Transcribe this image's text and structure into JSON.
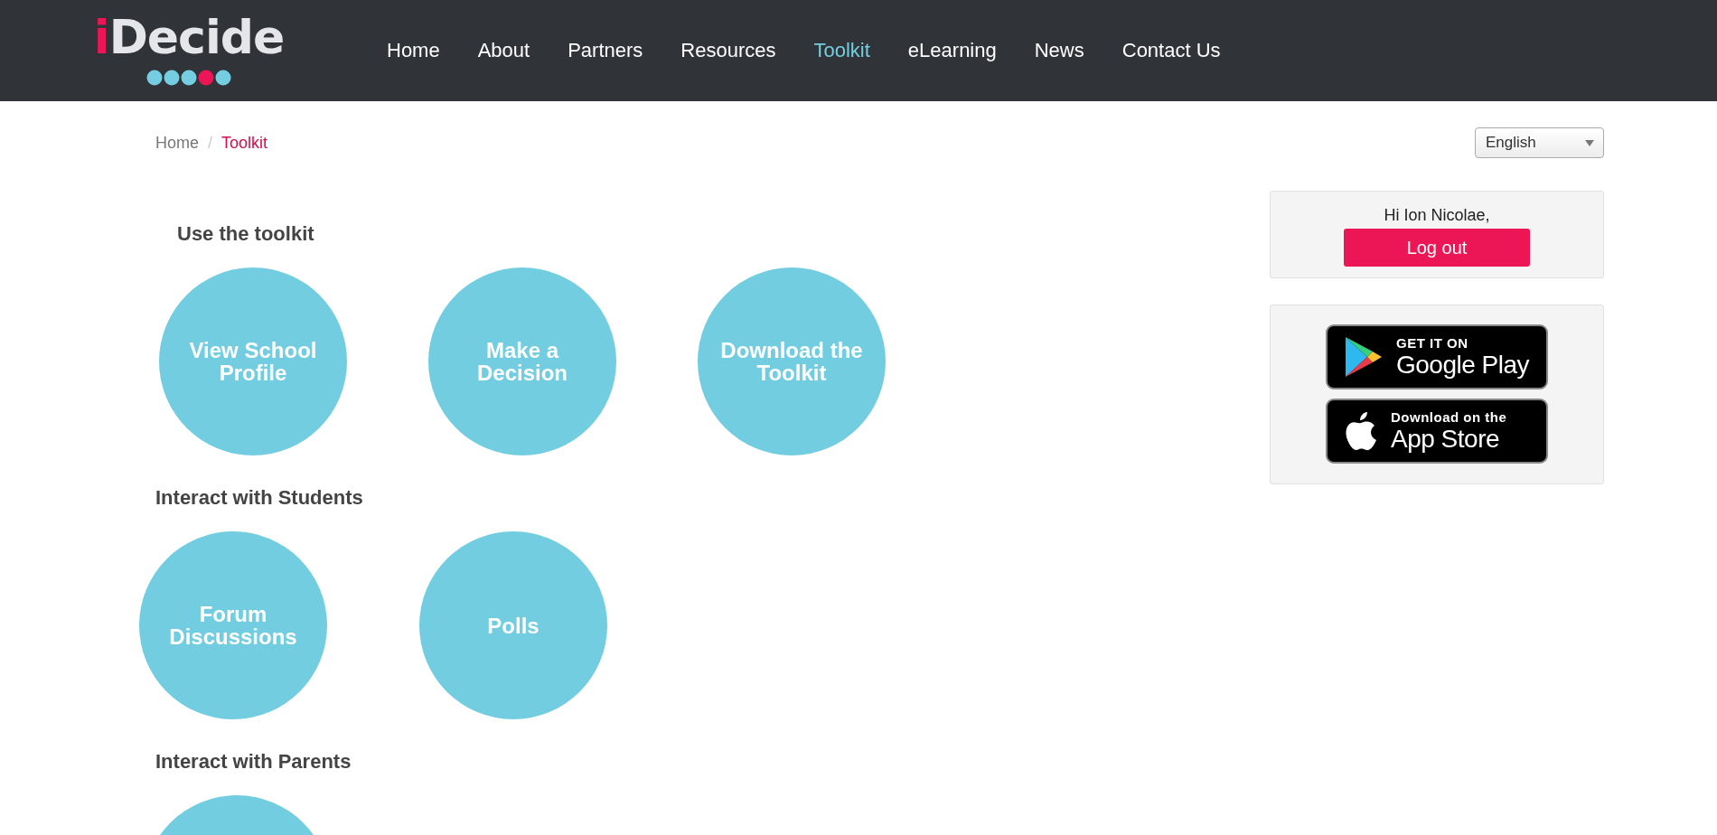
{
  "logo": {
    "accent": "i",
    "text": "Decide",
    "dots": [
      {
        "color": "#74cde0"
      },
      {
        "color": "#74cde0"
      },
      {
        "color": "#74cde0"
      },
      {
        "color": "#ec1656"
      },
      {
        "color": "#74cde0"
      }
    ]
  },
  "nav": [
    {
      "label": "Home",
      "selected": false
    },
    {
      "label": "About",
      "selected": false
    },
    {
      "label": "Partners",
      "selected": false
    },
    {
      "label": "Resources",
      "selected": false
    },
    {
      "label": "Toolkit",
      "selected": true
    },
    {
      "label": "eLearning",
      "selected": false
    },
    {
      "label": "News",
      "selected": false
    },
    {
      "label": "Contact Us",
      "selected": false
    }
  ],
  "breadcrumb": [
    {
      "label": "Home",
      "selected": false
    },
    {
      "label": "Toolkit",
      "selected": true
    }
  ],
  "breadcrumb_separator": "/",
  "language": {
    "value": "English"
  },
  "sections": [
    {
      "title": "Use the toolkit",
      "circles": [
        {
          "kind": "labeled",
          "label": "View School Profile"
        },
        {
          "kind": "labeled",
          "label": "Make a Decision"
        },
        {
          "kind": "labeled",
          "label": "Download the Toolkit"
        }
      ]
    },
    {
      "title": "Interact with Students",
      "circles": [
        {
          "kind": "labeled",
          "label": "Forum Discussions"
        },
        {
          "kind": "labeled",
          "label": "Polls"
        }
      ]
    },
    {
      "title": "Interact with Parents",
      "circles": [
        {
          "kind": "blank"
        }
      ]
    }
  ],
  "user_card": {
    "greeting": "Hi Ion Nicolae,",
    "button": "Log out"
  },
  "store_badges": [
    {
      "kind": "google",
      "small": "GET IT ON",
      "big": "Google Play"
    },
    {
      "kind": "apple",
      "small": "Download on the",
      "big": "App Store"
    }
  ]
}
